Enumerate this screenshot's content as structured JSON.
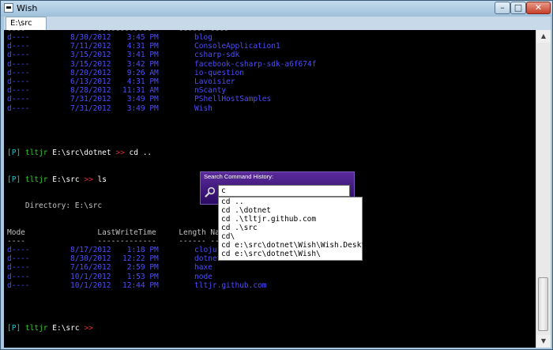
{
  "window": {
    "title": "Wish",
    "minimize": "–",
    "maximize": "□",
    "close": "✕"
  },
  "tab": {
    "label": "E:\\src"
  },
  "console": {
    "lines": [
      {
        "mode": "----",
        "rest": "                ------------      ------ ----"
      },
      {
        "mode": "d----",
        "date": "8/30/2012",
        "time": " 3:45 PM",
        "name": "blog"
      },
      {
        "mode": "d----",
        "date": "7/11/2012",
        "time": " 4:31 PM",
        "name": "ConsoleApplication1"
      },
      {
        "mode": "d----",
        "date": "3/15/2012",
        "time": " 3:41 PM",
        "name": "csharp-sdk"
      },
      {
        "mode": "d----",
        "date": "3/15/2012",
        "time": " 3:42 PM",
        "name": "facebook-csharp-sdk-a6f674f"
      },
      {
        "mode": "d----",
        "date": "8/20/2012",
        "time": " 9:26 AM",
        "name": "io-question"
      },
      {
        "mode": "d----",
        "date": "6/13/2012",
        "time": " 4:31 PM",
        "name": "Lavoisier"
      },
      {
        "mode": "d----",
        "date": "8/28/2012",
        "time": "11:31 AM",
        "name": "nScanty"
      },
      {
        "mode": "d----",
        "date": "7/31/2012",
        "time": " 3:49 PM",
        "name": "PShellHostSamples"
      },
      {
        "mode": "d----",
        "date": "7/31/2012",
        "time": " 3:49 PM",
        "name": "Wish"
      }
    ],
    "prompt1": {
      "tag": "[P]",
      "user": "tltjr",
      "path": "E:\\src\\dotnet",
      "arrow": ">>",
      "cmd": "cd .."
    },
    "prompt2": {
      "tag": "[P]",
      "user": "tltjr",
      "path": "E:\\src",
      "arrow": ">>",
      "cmd": "ls"
    },
    "directory": "    Directory: E:\\src",
    "header": "Mode                LastWriteTime     Length Name",
    "header_rule": "----                -------------     ------ ----",
    "lines2": [
      {
        "mode": "d----",
        "date": "8/17/2012",
        "time": " 1:18 PM",
        "name": "clojure"
      },
      {
        "mode": "d----",
        "date": "8/30/2012",
        "time": "12:22 PM",
        "name": "dotnet"
      },
      {
        "mode": "d----",
        "date": "7/16/2012",
        "time": " 2:59 PM",
        "name": "haxe"
      },
      {
        "mode": "d----",
        "date": "10/1/2012",
        "time": " 1:53 PM",
        "name": "node"
      },
      {
        "mode": "d----",
        "date": "10/1/2012",
        "time": "12:44 PM",
        "name": "tltjr.github.com"
      }
    ],
    "prompt3": {
      "tag": "[P]",
      "user": "tltjr",
      "path": "E:\\src",
      "arrow": ">>"
    }
  },
  "popup": {
    "title": "Search Command History:",
    "input_value": "c",
    "suggestions": [
      "cd ..",
      "cd .\\dotnet",
      "cd .\\tltjr.github.com",
      "cd .\\src",
      "cd\\",
      "cd e:\\src\\dotnet\\Wish\\Wish.Desktop",
      "cd e:\\src\\dotnet\\Wish\\"
    ]
  },
  "scrollbar": {
    "up": "▲",
    "down": "▼"
  }
}
